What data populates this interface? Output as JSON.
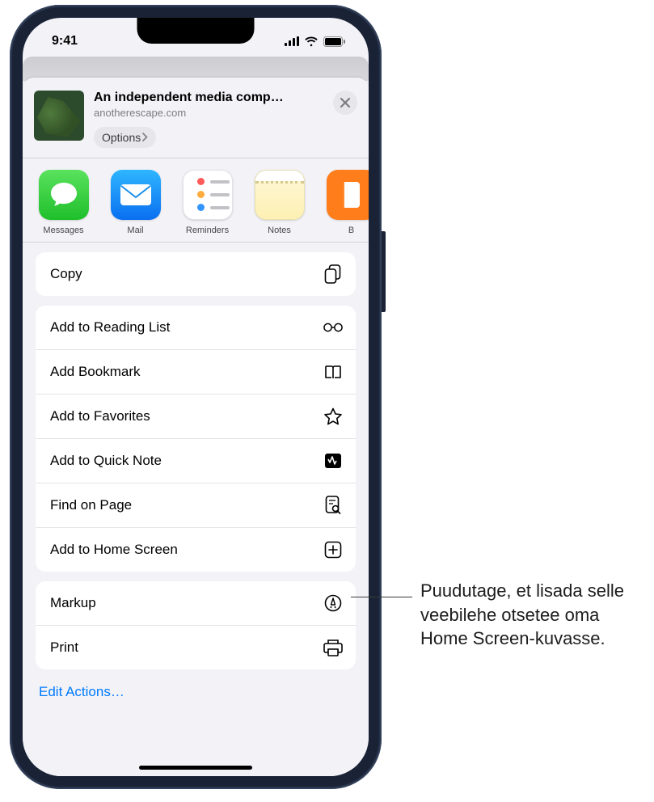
{
  "status": {
    "time": "9:41"
  },
  "sheet": {
    "title": "An independent media comp…",
    "domain": "anotherescape.com",
    "options_label": "Options"
  },
  "apps": [
    {
      "label": "Messages"
    },
    {
      "label": "Mail"
    },
    {
      "label": "Reminders"
    },
    {
      "label": "Notes"
    },
    {
      "label": "B"
    }
  ],
  "actions": {
    "copy": "Copy",
    "reading_list": "Add to Reading List",
    "bookmark": "Add Bookmark",
    "favorites": "Add to Favorites",
    "quick_note": "Add to Quick Note",
    "find_on_page": "Find on Page",
    "home_screen": "Add to Home Screen",
    "markup": "Markup",
    "print": "Print",
    "edit": "Edit Actions…"
  },
  "callout": "Puudutage, et lisada selle veebilehe otsetee oma Home Screen-kuvasse."
}
